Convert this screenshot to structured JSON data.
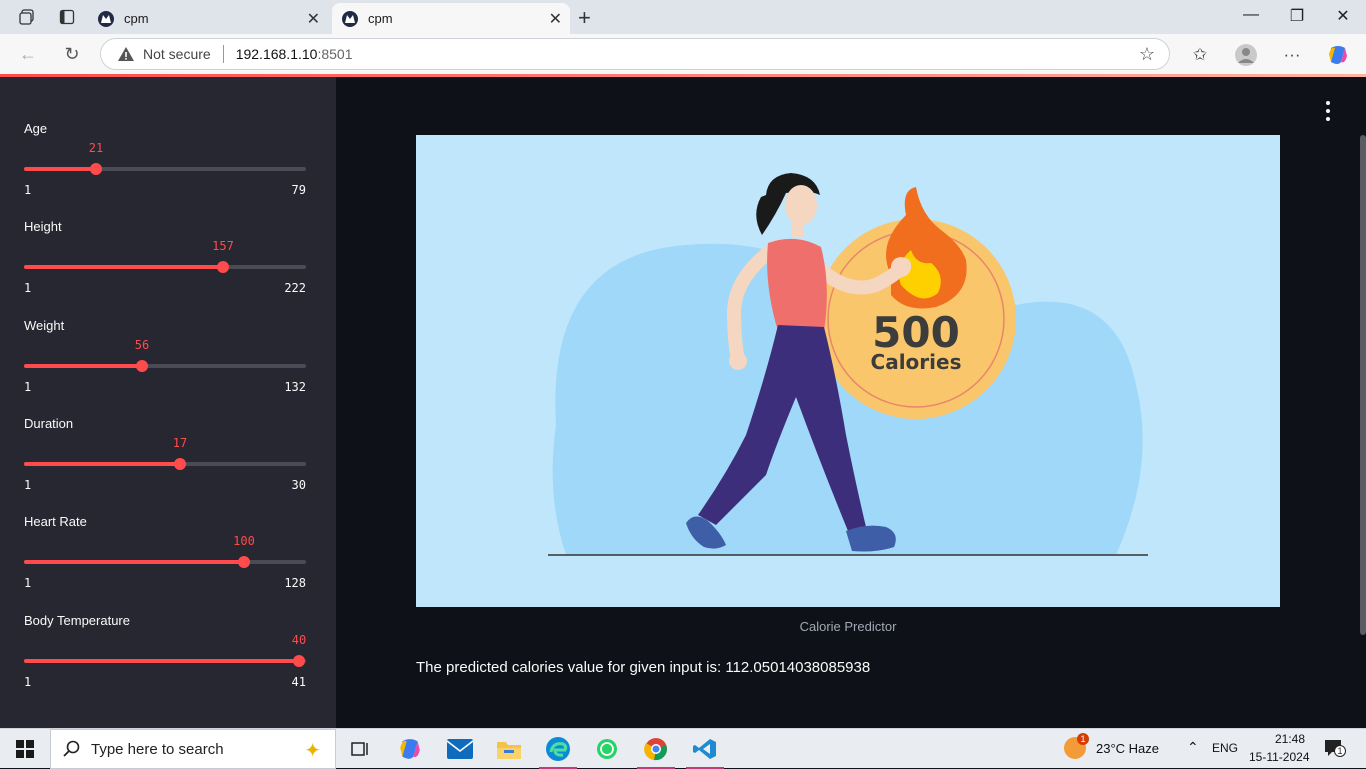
{
  "browser": {
    "tabs": [
      {
        "title": "cpm",
        "active": false
      },
      {
        "title": "cpm",
        "active": true
      }
    ],
    "address": {
      "security_label": "Not secure",
      "host": "192.168.1.10",
      "port": ":8501"
    },
    "accent": "#ff4b4b"
  },
  "sidebar": {
    "sliders": [
      {
        "label": "Age",
        "value": "21",
        "min": "1",
        "max": "79",
        "fraction": 0.2564
      },
      {
        "label": "Height",
        "value": "157",
        "min": "1",
        "max": "222",
        "fraction": 0.7059
      },
      {
        "label": "Weight",
        "value": "56",
        "min": "1",
        "max": "132",
        "fraction": 0.4198
      },
      {
        "label": "Duration",
        "value": "17",
        "min": "1",
        "max": "30",
        "fraction": 0.5517
      },
      {
        "label": "Heart Rate",
        "value": "100",
        "min": "1",
        "max": "128",
        "fraction": 0.7795
      },
      {
        "label": "Body Temperature",
        "value": "40",
        "min": "1",
        "max": "41",
        "fraction": 0.975
      }
    ]
  },
  "main": {
    "image": {
      "badge_number": "500",
      "badge_text": "Calories"
    },
    "caption": "Calorie Predictor",
    "result_text": "The predicted calories value for given input is: 112.05014038085938"
  },
  "taskbar": {
    "search_placeholder": "Type here to search",
    "weather_badge": "1",
    "weather": "23°C  Haze",
    "language": "ENG",
    "time": "21:48",
    "date": "15-11-2024",
    "notification_count": "1"
  }
}
